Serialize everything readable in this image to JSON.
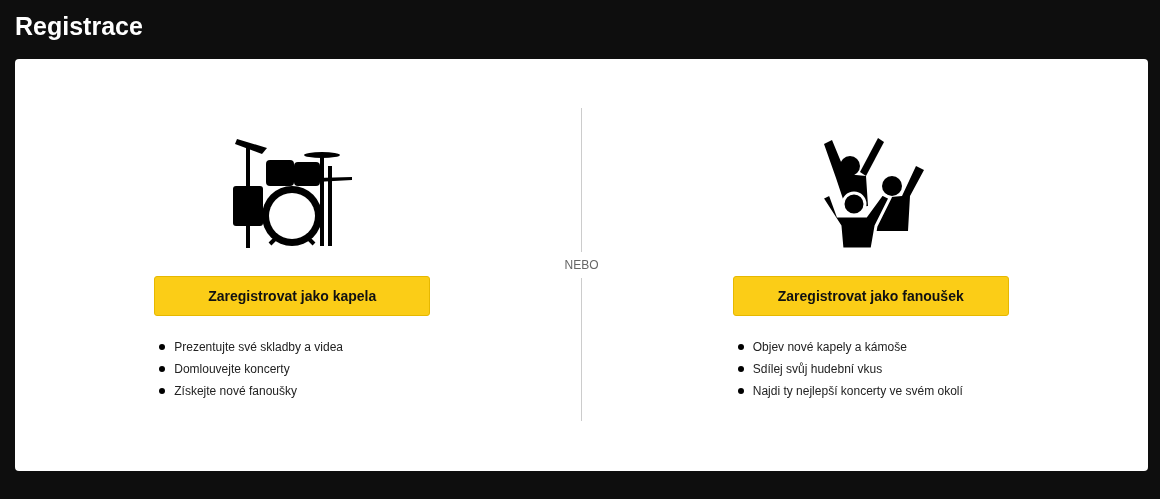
{
  "page_title": "Registrace",
  "separator": "NEBO",
  "options": [
    {
      "kind": "band",
      "button": "Zaregistrovat jako kapela",
      "features": [
        "Prezentujte své skladby a videa",
        "Domlouvejte koncerty",
        "Získejte nové fanoušky"
      ]
    },
    {
      "kind": "fan",
      "button": "Zaregistrovat jako fanoušek",
      "features": [
        "Objev nové kapely a kámoše",
        "Sdílej svůj hudební vkus",
        "Najdi ty nejlepší koncerty ve svém okolí"
      ]
    }
  ]
}
